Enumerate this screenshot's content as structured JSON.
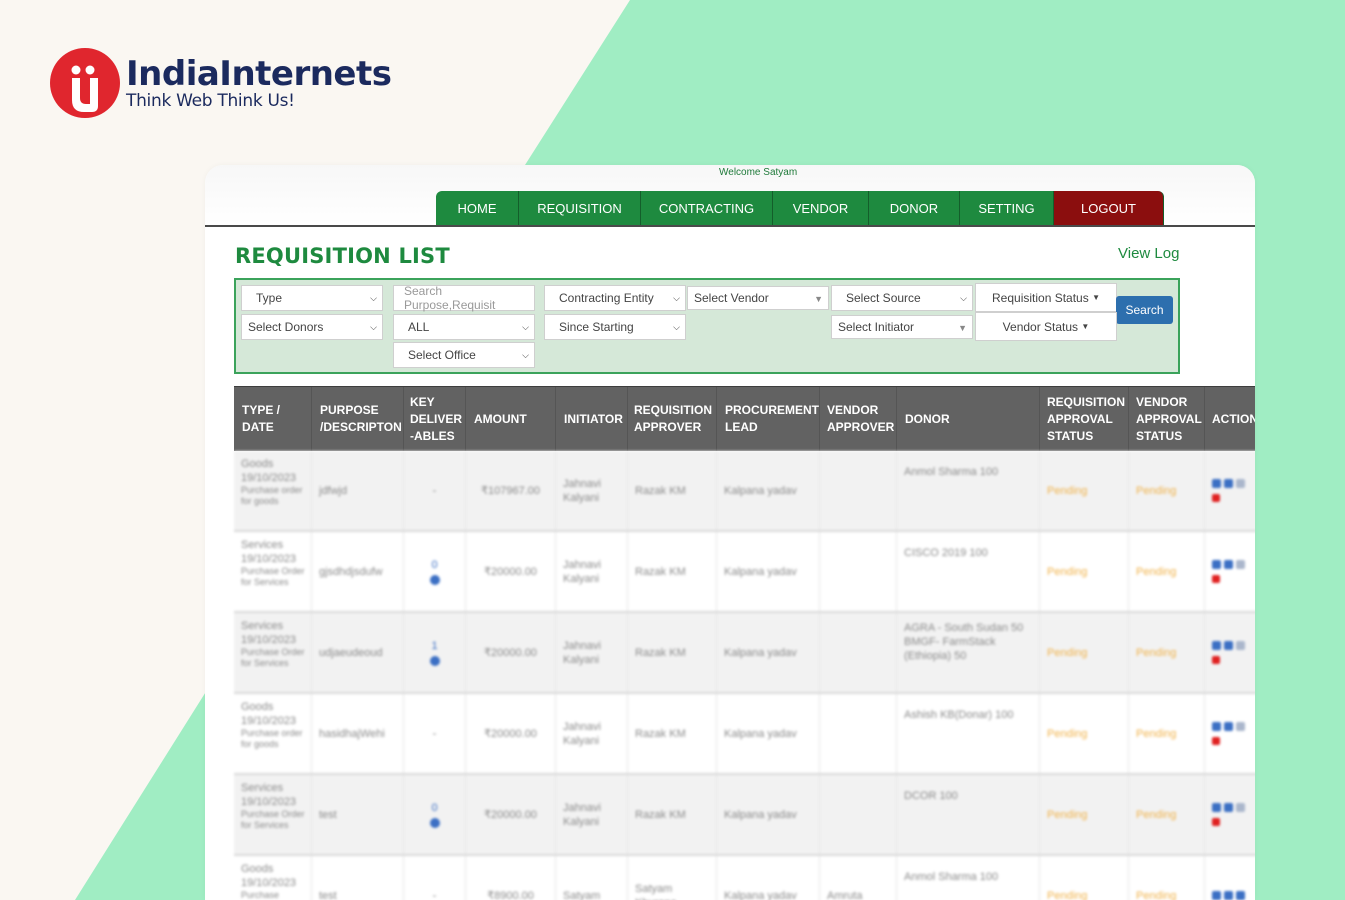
{
  "brand": {
    "name": "IndiaInternets",
    "tagline": "Think Web Think Us!"
  },
  "colors": {
    "brand_red": "#e0262e",
    "brand_navy": "#1b2a5e",
    "bg_mint": "#a0edc3",
    "nav_green": "#1e8a3f",
    "logout_red": "#8b0e0e",
    "search_blue": "#2d6fae"
  },
  "app": {
    "welcome": "Welcome Satyam",
    "nav": [
      "HOME",
      "REQUISITION",
      "CONTRACTING",
      "VENDOR",
      "DONOR",
      "SETTING",
      "LOGOUT"
    ],
    "page_title": "REQUISITION LIST",
    "view_log": "View Log",
    "filters": {
      "type": "Type",
      "search_placeholder": "Search Purpose,Requisit",
      "contracting_entity": "Contracting Entity",
      "vendor": "Select Vendor",
      "source": "Select Source",
      "requisition_status": "Requisition Status",
      "donors": "Select Donors",
      "all": "ALL",
      "since": "Since Starting",
      "initiator": "Select Initiator",
      "vendor_status": "Vendor Status",
      "office": "Select Office",
      "search_button": "Search"
    },
    "table": {
      "headers": [
        "TYPE / DATE",
        "PURPOSE /DESCRIPTON",
        "KEY DELIVER -ABLES",
        "AMOUNT",
        "INITIATOR",
        "REQUISITION APPROVER",
        "PROCUREMENT LEAD",
        "VENDOR APPROVER",
        "DONOR",
        "REQUISITION APPROVAL STATUS",
        "VENDOR APPROVAL STATUS",
        "ACTION"
      ],
      "rows": [
        {
          "type": "Goods",
          "date": "19/10/2023",
          "note": "Purchase order for goods",
          "purpose": "jdfwjd",
          "deliverables": "-",
          "amount": "₹107967.00",
          "initiator": "Jahnavi Kalyani",
          "approver": "Razak KM",
          "lead": "Kalpana yadav",
          "vendor_approver": "",
          "donor": "Anmol Sharma 100",
          "req_status": "Pending",
          "vendor_status": "Pending"
        },
        {
          "type": "Services",
          "date": "19/10/2023",
          "note": "Purchase Order for Services",
          "purpose": "gjsdhdjsdufw",
          "deliverables": "0",
          "amount": "₹20000.00",
          "initiator": "Jahnavi Kalyani",
          "approver": "Razak KM",
          "lead": "Kalpana yadav",
          "vendor_approver": "",
          "donor": "CISCO 2019 100",
          "req_status": "Pending",
          "vendor_status": "Pending"
        },
        {
          "type": "Services",
          "date": "19/10/2023",
          "note": "Purchase Order for Services",
          "purpose": "udjaeudeoud",
          "deliverables": "1",
          "amount": "₹20000.00",
          "initiator": "Jahnavi Kalyani",
          "approver": "Razak KM",
          "lead": "Kalpana yadav",
          "vendor_approver": "",
          "donor": "AGRA - South Sudan 50 BMGF- FarmStack (Ethiopia) 50",
          "req_status": "Pending",
          "vendor_status": "Pending"
        },
        {
          "type": "Goods",
          "date": "19/10/2023",
          "note": "Purchase order for goods",
          "purpose": "hasidhajWehi",
          "deliverables": "-",
          "amount": "₹20000.00",
          "initiator": "Jahnavi Kalyani",
          "approver": "Razak KM",
          "lead": "Kalpana yadav",
          "vendor_approver": "",
          "donor": "Ashish KB(Donar) 100",
          "req_status": "Pending",
          "vendor_status": "Pending"
        },
        {
          "type": "Services",
          "date": "19/10/2023",
          "note": "Purchase Order for Services",
          "purpose": "test",
          "deliverables": "0",
          "amount": "₹20000.00",
          "initiator": "Jahnavi Kalyani",
          "approver": "Razak KM",
          "lead": "Kalpana yadav",
          "vendor_approver": "",
          "donor": "DCOR 100",
          "req_status": "Pending",
          "vendor_status": "Pending"
        },
        {
          "type": "Goods",
          "date": "19/10/2023",
          "note": "Purchase",
          "purpose": "test",
          "deliverables": "-",
          "amount": "₹8900.00",
          "initiator": "Satyam",
          "approver": "Satyam Khurana",
          "lead": "Kalpana yadav",
          "vendor_approver": "Amruta",
          "donor": "Anmol Sharma 100",
          "req_status": "Pending",
          "vendor_status": "Pending"
        }
      ]
    }
  }
}
